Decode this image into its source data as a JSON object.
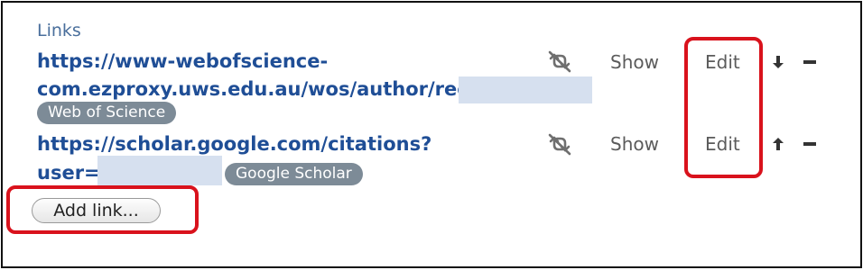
{
  "section": {
    "title": "Links"
  },
  "links": [
    {
      "url_line1": "https://www-webofscience-",
      "url_line2": "com.ezproxy.uws.edu.au/wos/author/record/N",
      "badge": "Web of Science",
      "show_label": "Show",
      "edit_label": "Edit",
      "move_icon": "arrow-down-icon",
      "hide_icon": "eye-slash-icon",
      "remove_icon": "minus-icon"
    },
    {
      "url_line1": "https://scholar.google.com/citations?",
      "url_line2": "user=",
      "badge": "Google Scholar",
      "show_label": "Show",
      "edit_label": "Edit",
      "move_icon": "arrow-up-icon",
      "hide_icon": "eye-slash-icon",
      "remove_icon": "minus-icon"
    }
  ],
  "add_link": {
    "label": "Add link..."
  },
  "colors": {
    "link": "#1f4e96",
    "section_title": "#4a6f9c",
    "badge_bg": "#7d8b97",
    "highlight": "#d9121c",
    "redaction": "#d6e0ef"
  }
}
